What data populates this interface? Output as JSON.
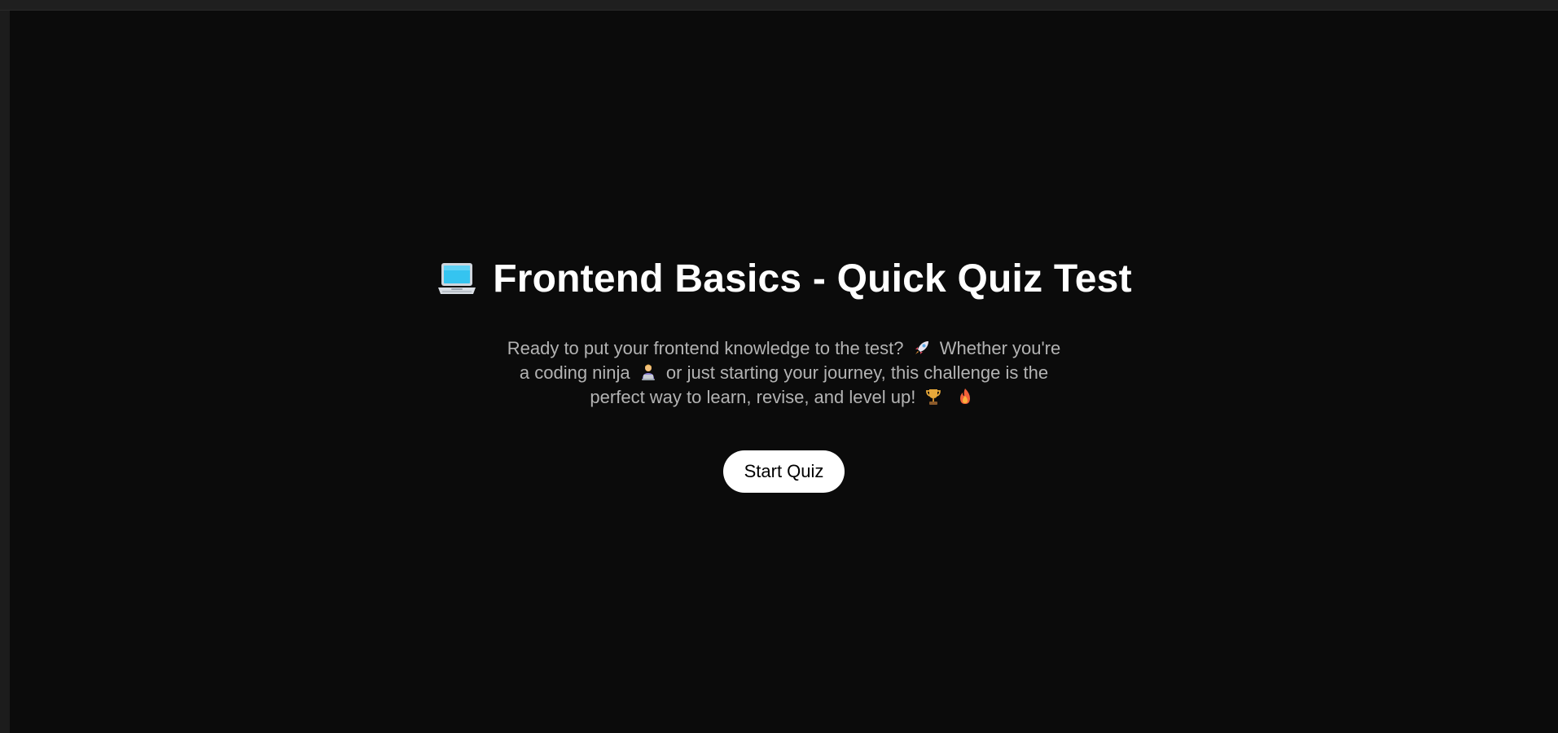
{
  "hero": {
    "title_icon": "laptop-icon",
    "title": "Frontend Basics - Quick Quiz Test",
    "subtitle": {
      "part1": "Ready to put your frontend knowledge to the test?",
      "icon1": "rocket-icon",
      "part2": "Whether you're a coding ninja",
      "icon2": "technologist-icon",
      "part3": "or just starting your journey, this challenge is the perfect way to learn, revise, and level up!",
      "icon3": "trophy-icon",
      "icon4": "fire-icon"
    },
    "start_label": "Start Quiz"
  },
  "colors": {
    "page_background": "#0b0b0b",
    "outer_background": "#1c1c1c",
    "title_text": "#ffffff",
    "subtitle_text": "#b3b3b3",
    "button_background": "#ffffff",
    "button_text": "#000000"
  }
}
